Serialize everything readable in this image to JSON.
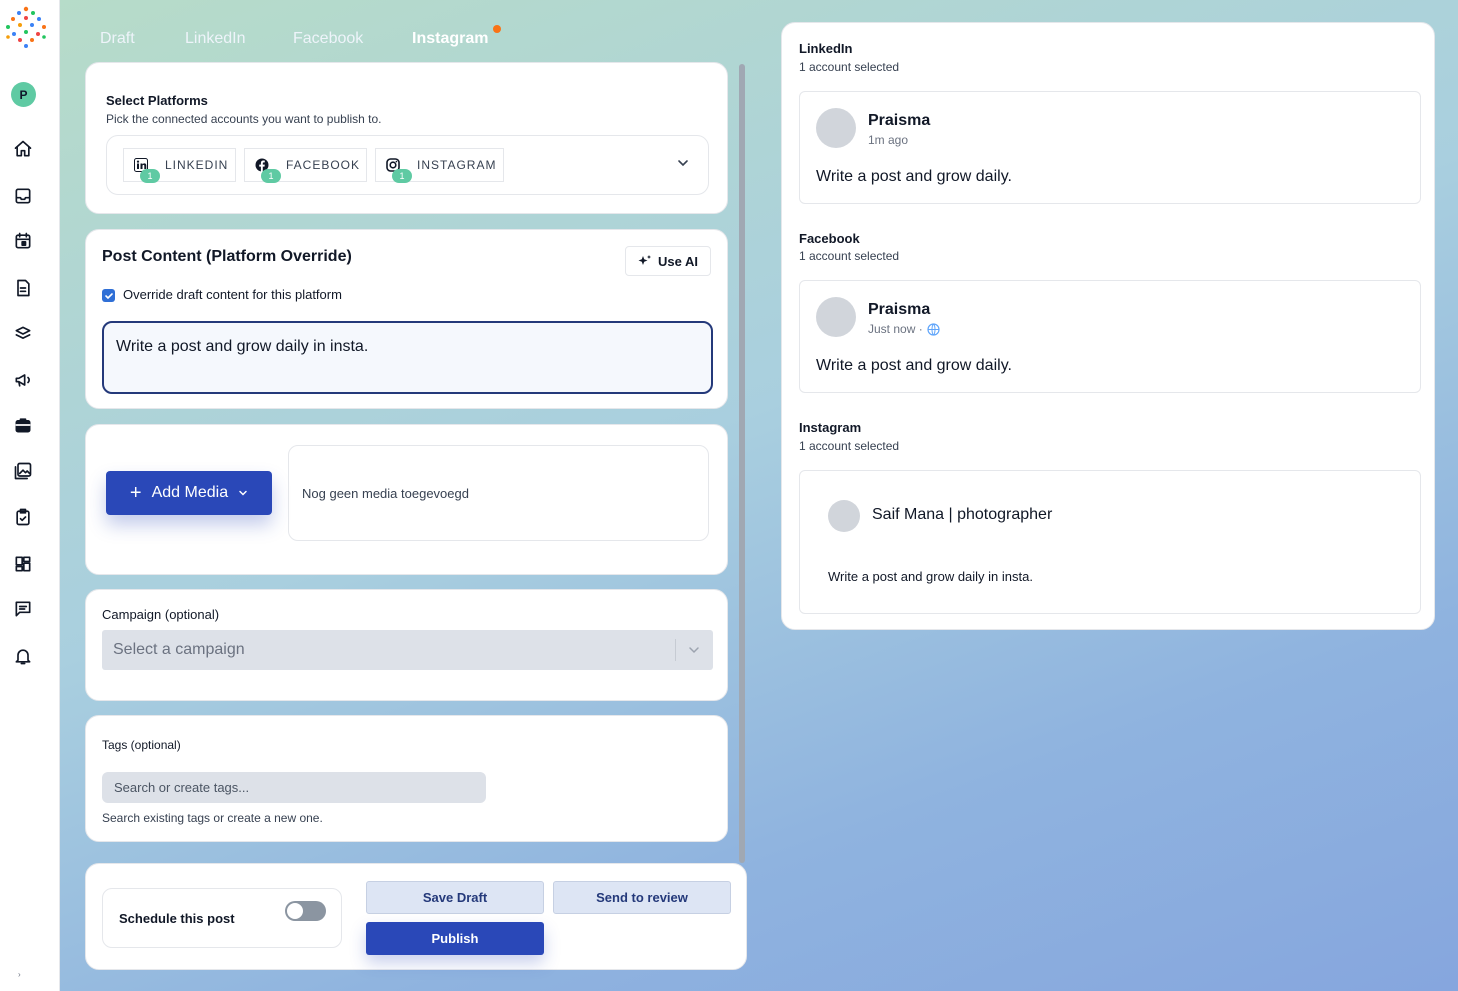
{
  "user": {
    "avatar_initial": "P"
  },
  "tabs": [
    {
      "label": "Draft"
    },
    {
      "label": "LinkedIn"
    },
    {
      "label": "Facebook"
    },
    {
      "label": "Instagram"
    }
  ],
  "colors": {
    "accent": "#2a48b8",
    "badge": "#5fcaa3",
    "notification_dot": "#f97316",
    "text_area_border": "#24397a"
  },
  "icons": {
    "sidebar": [
      "home-icon",
      "inbox-icon",
      "calendar-icon",
      "document-icon",
      "layers-icon",
      "megaphone-icon",
      "briefcase-icon",
      "image-icon",
      "clipboard-check-icon",
      "dashboard-icon",
      "message-icon",
      "bell-icon"
    ]
  },
  "platforms": {
    "title": "Select Platforms",
    "subtitle": "Pick the connected accounts you want to publish to.",
    "chips": [
      {
        "label": "LINKEDIN",
        "count": "1",
        "icon": "linkedin-icon"
      },
      {
        "label": "FACEBOOK",
        "count": "1",
        "icon": "facebook-icon"
      },
      {
        "label": "INSTAGRAM",
        "count": "1",
        "icon": "instagram-icon"
      }
    ]
  },
  "post_content": {
    "title": "Post Content (Platform Override)",
    "use_ai_label": "Use AI",
    "override_label": "Override draft content for this platform",
    "override_checked": true,
    "text": "Write a post and grow daily in insta."
  },
  "media": {
    "add_label": "Add Media",
    "empty_text": "Nog geen media toegevoegd"
  },
  "campaign": {
    "label": "Campaign (optional)",
    "placeholder": "Select a campaign"
  },
  "tags": {
    "label": "Tags (optional)",
    "placeholder": "Search or create tags...",
    "help": "Search existing tags or create a new one."
  },
  "footer": {
    "schedule_label": "Schedule this post",
    "schedule_on": false,
    "save_draft": "Save Draft",
    "send_review": "Send to review",
    "publish": "Publish"
  },
  "preview": {
    "linkedin": {
      "title": "LinkedIn",
      "sub": "1 account selected",
      "name": "Praisma",
      "time": "1m ago",
      "text": "Write a post and grow daily."
    },
    "facebook": {
      "title": "Facebook",
      "sub": "1 account selected",
      "name": "Praisma",
      "time": "Just now ·",
      "text": "Write a post and grow daily."
    },
    "instagram": {
      "title": "Instagram",
      "sub": "1 account selected",
      "name": "Saif Mana | photographer",
      "text": "Write a post and grow daily in insta."
    }
  }
}
